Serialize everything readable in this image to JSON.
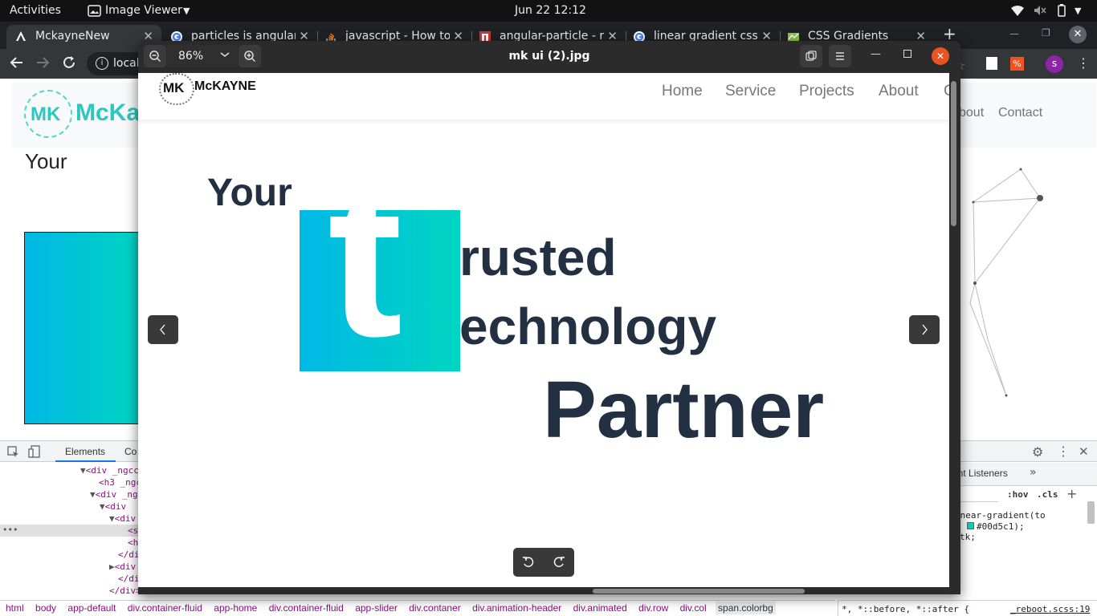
{
  "topbar": {
    "activities": "Activities",
    "app_name": "Image Viewer",
    "clock": "Jun 22  12:12"
  },
  "browser": {
    "tabs": [
      {
        "label": "MckayneNew"
      },
      {
        "label": "particles is angular"
      },
      {
        "label": "javascript - How to"
      },
      {
        "label": "angular-particle - n"
      },
      {
        "label": "linear gradient css"
      },
      {
        "label": "CSS Gradients"
      }
    ],
    "address": "local",
    "profile_initial": "s"
  },
  "page": {
    "logo_text": "McKa",
    "nav": [
      "bout",
      "Contact"
    ],
    "heading": "Your"
  },
  "devtools": {
    "tabs": [
      "Elements",
      "Co"
    ],
    "code_lines": [
      "<div _ngcc",
      "<h3 _ngc",
      "<div _ng",
      "<div",
      "<div",
      "<s",
      "<h",
      "</di",
      "<div",
      "</div>",
      "</div>"
    ],
    "right_tab": "ent Listeners",
    "hov": ":hov",
    "cls": ".cls",
    "style_lines": [
      "inear-gradient(to",
      "#00d5c1);",
      "tk;"
    ],
    "selector_rule": "*, *::before, *::after {",
    "source_file": "_reboot.scss:19",
    "breadcrumbs": [
      "html",
      "body",
      "app-default",
      "div.container-fluid",
      "app-home",
      "div.container-fluid",
      "app-slider",
      "div.contaner",
      "div.animation-header",
      "div.animated",
      "div.row",
      "div.col",
      "span.colorbg"
    ]
  },
  "viewer": {
    "zoom": "86%",
    "title": "mk ui (2).jpg",
    "image": {
      "logo_text": "McKAYNE",
      "nav": [
        "Home",
        "Service",
        "Projects",
        "About",
        "C"
      ],
      "hero_word1": "Your",
      "big_letter": "t",
      "line2": "rusted",
      "line3": "echnology",
      "line4": "Partner"
    }
  },
  "colors": {
    "gradient_start": "#00b8e6",
    "gradient_end": "#00d5c1",
    "hero_text": "#223041",
    "close_orange": "#e95420"
  }
}
